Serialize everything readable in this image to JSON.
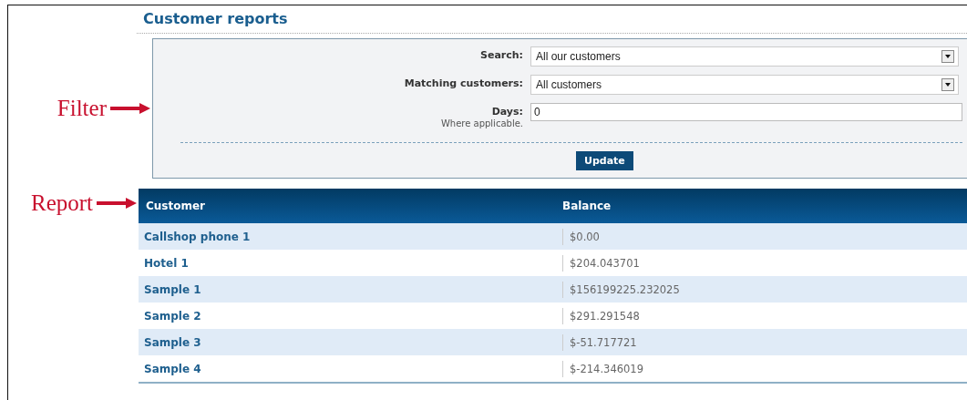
{
  "page": {
    "title": "Customer reports"
  },
  "annotations": {
    "filter": "Filter",
    "report": "Report"
  },
  "filter": {
    "fields": [
      {
        "kind": "select",
        "label": "Search:",
        "value": "All our customers"
      },
      {
        "kind": "select",
        "label": "Matching customers:",
        "value": "All customers"
      },
      {
        "kind": "text",
        "label": "Days:",
        "hint": "Where applicable.",
        "value": "0"
      }
    ],
    "button": "Update"
  },
  "table": {
    "columns": [
      "Customer",
      "Balance"
    ],
    "rows": [
      {
        "customer": "Callshop phone 1",
        "balance": "$0.00"
      },
      {
        "customer": "Hotel 1",
        "balance": "$204.043701"
      },
      {
        "customer": "Sample 1",
        "balance": "$156199225.232025"
      },
      {
        "customer": "Sample 2",
        "balance": "$291.291548"
      },
      {
        "customer": "Sample 3",
        "balance": "$-51.717721"
      },
      {
        "customer": "Sample 4",
        "balance": "$-214.346019"
      }
    ]
  }
}
